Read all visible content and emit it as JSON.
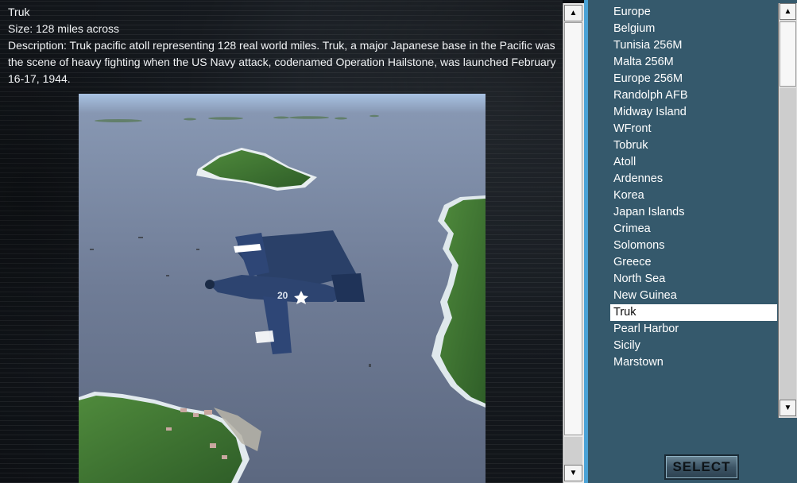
{
  "map_info": {
    "title": "Truk",
    "size": "Size: 128 miles across",
    "description": "Description: Truk pacific atoll representing 128 real world miles. Truk, a major Japanese base in the Pacific was the scene of heavy fighting when the US Navy attack, codenamed Operation Hailstone, was launched February 16-17, 1944."
  },
  "aircraft": {
    "number": "20"
  },
  "map_list": {
    "items": [
      "Europe",
      "Belgium",
      "Tunisia 256M",
      "Malta 256M",
      "Europe 256M",
      "Randolph AFB",
      "Midway Island",
      "WFront",
      "Tobruk",
      "Atoll",
      "Ardennes",
      "Korea",
      "Japan Islands",
      "Crimea",
      "Solomons",
      "Greece",
      "North Sea",
      "New Guinea",
      "Truk",
      "Pearl Harbor",
      "Sicily",
      "Marstown"
    ],
    "selected": "Truk"
  },
  "scrollbar": {
    "up_icon": "up-arrow-icon",
    "down_icon": "down-arrow-icon"
  },
  "select_button": {
    "label": "SELECT"
  },
  "colors": {
    "list_background": "#35596c",
    "divider": "#4aa2d6",
    "selection": "#ffffff"
  }
}
